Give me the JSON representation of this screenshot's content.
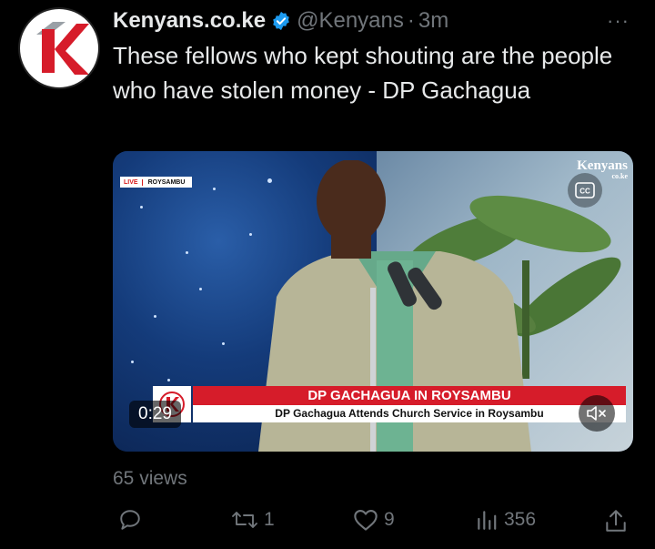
{
  "tweet": {
    "author": {
      "display_name": "Kenyans.co.ke",
      "handle": "@Kenyans",
      "separator": "·",
      "time": "3m",
      "verified": true,
      "avatar_icon": "kenyans-logo"
    },
    "more_label": "···",
    "text": "These fellows who kept shouting are the people who have stolen money - DP Gachagua",
    "media": {
      "live_label": "LIVE",
      "location_label": "ROYSAMBU",
      "watermark_line1": "Kenyans",
      "watermark_line2": "co.ke",
      "headline": "DP GACHAGUA IN ROYSAMBU",
      "subheadline": "DP Gachagua Attends Church Service in Roysambu",
      "duration": "0:29",
      "cc_icon": "closed-captions-icon",
      "mute_icon": "muted-speaker-icon"
    },
    "views": "65 views",
    "actions": {
      "reply_count": "",
      "retweet_count": "1",
      "like_count": "9",
      "view_count": "356"
    }
  },
  "colors": {
    "background": "#000000",
    "text": "#e7e9ea",
    "secondary": "#71767b",
    "verified": "#1d9bf0",
    "brand_red": "#d61c2a"
  }
}
